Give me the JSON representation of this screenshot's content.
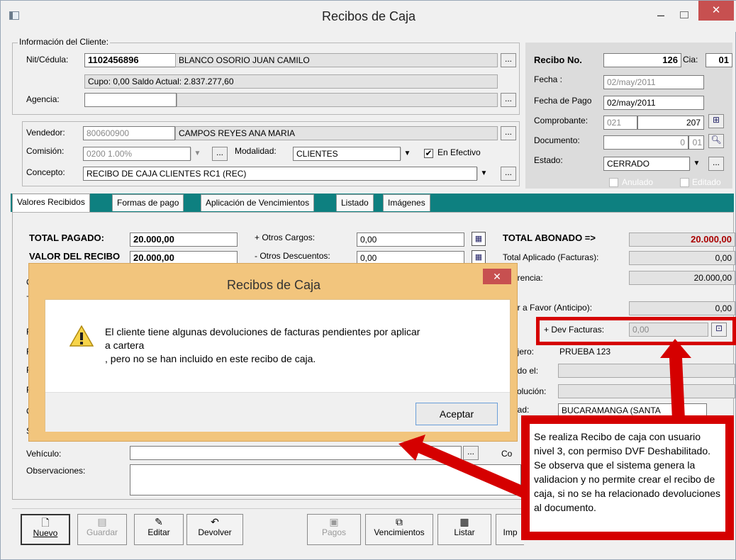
{
  "window": {
    "title": "Recibos de Caja",
    "controls": {
      "minimize": "–",
      "maximize": "□",
      "close": "✕"
    }
  },
  "cliente": {
    "group_label": "Información del Cliente:",
    "nit_label": "Nit/Cédula:",
    "nit_value": "1102456896",
    "nombre": "BLANCO OSORIO JUAN CAMILO",
    "cupo": "Cupo: 0,00 Saldo Actual: 2.837.277,60",
    "agencia_label": "Agencia:",
    "agencia_value": "",
    "browse": "..."
  },
  "vendedor": {
    "label": "Vendedor:",
    "codigo": "800600900",
    "nombre": "CAMPOS REYES ANA MARIA",
    "comision_label": "Comisión:",
    "comision_value": "0200  1.00%",
    "modalidad_label": "Modalidad:",
    "modalidad_value": "CLIENTES",
    "en_efectivo_label": "En Efectivo",
    "en_efectivo_checked": "✔",
    "concepto_label": "Concepto:",
    "concepto_value": "RECIBO DE CAJA CLIENTES RC1 (REC)"
  },
  "recibo": {
    "numero_label": "Recibo No.",
    "numero_value": "126",
    "cia_label": "Cia:",
    "cia_value": "01",
    "fecha_label": "Fecha :",
    "fecha_value": "02/may/2011",
    "fecha_pago_label": "Fecha de Pago",
    "fecha_pago_value": "02/may/2011",
    "comprobante_label": "Comprobante:",
    "comprobante_tipo": "021",
    "comprobante_num": "207",
    "documento_label": "Documento:",
    "documento_num": "0",
    "documento_cia": "01",
    "estado_label": "Estado:",
    "estado_value": "CERRADO",
    "anulado_label": "Anulado",
    "editado_label": "Editado"
  },
  "tabs": [
    "Valores Recibidos",
    "Formas de pago",
    "Aplicación de Vencimientos",
    "Listado",
    "Imágenes"
  ],
  "valores": {
    "total_pagado_label": "TOTAL PAGADO:",
    "total_pagado_value": "20.000,00",
    "valor_recibo_label": "VALOR DEL RECIBO",
    "valor_recibo_value": "20.000,00",
    "otros_cargos_label": "+ Otros Cargos:",
    "otros_cargos_value": "0,00",
    "otros_descuentos_label": "- Otros Descuentos:",
    "otros_descuentos_value": "0,00",
    "total_abonado_label": "TOTAL ABONADO =>",
    "total_abonado_value": "20.000,00",
    "total_aplicado_label": "Total Aplicado (Facturas):",
    "total_aplicado_value": "0,00",
    "diferencia_label": "erencia:",
    "diferencia_value": "20.000,00",
    "favor_label": "or a Favor (Anticipo):",
    "favor_value": "0,00",
    "dev_facturas_label": "+ Dev Facturas:",
    "dev_facturas_value": "0,00",
    "cajero_label": "ajero:",
    "cajero_value": "PRUEBA 123",
    "anulado_el_label": "ado el:",
    "devolucion_label": "volución:",
    "ciudad_label": "dad:",
    "ciudad_value": "BUCARAMANGA (SANTA",
    "vehiculo_label": "Vehículo:",
    "observaciones_label": "Observaciones:",
    "co_label": "Co",
    "left_fragments": [
      "C",
      "+",
      "F",
      "F",
      "F",
      "F",
      "C",
      "Su"
    ]
  },
  "toolbar": {
    "nuevo": "Nuevo",
    "guardar": "Guardar",
    "editar": "Editar",
    "devolver": "Devolver",
    "pagos": "Pagos",
    "vencimientos": "Vencimientos",
    "listar": "Listar",
    "imprimir": "Imp"
  },
  "dialog": {
    "title": "Recibos de Caja",
    "message_line1": "El cliente tiene algunas devoluciones de facturas pendientes por aplicar",
    "message_line2": "a cartera",
    "message_line3": ", pero no se han incluido en este recibo de caja.",
    "button": "Aceptar",
    "close": "✕",
    "icon": "warning-icon"
  },
  "annotation": {
    "text": "Se realiza Recibo de caja con usuario nivel 3, con permiso DVF Deshabilitado. Se observa que el sistema genera la validacion y no permite crear el recibo de caja, si no se ha relacionado devoluciones al documento.",
    "color": "#d50000"
  }
}
